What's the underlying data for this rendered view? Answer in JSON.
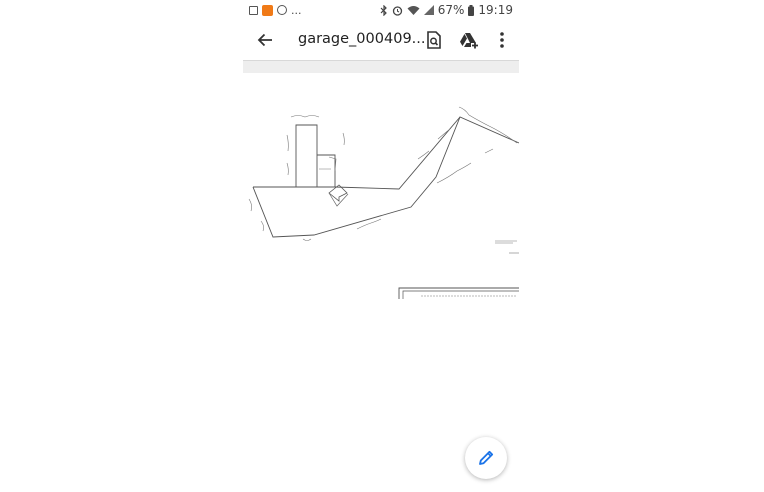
{
  "status_bar": {
    "left_icons": [
      "image-icon",
      "app-icon",
      "phone-icon"
    ],
    "more": "...",
    "right_icons": [
      "bluetooth-icon",
      "alarm-icon",
      "wifi-icon",
      "signal-icon"
    ],
    "battery": "67%",
    "time": "19:19"
  },
  "toolbar": {
    "title": "garage_000409...",
    "icons": [
      "back-arrow-icon",
      "search-document-icon",
      "drive-add-icon",
      "more-vert-icon"
    ]
  },
  "document": {
    "type": "hand-drawn site plan sketch"
  },
  "fab": {
    "icon": "edit-pencil-icon",
    "color": "#1a73e8"
  }
}
